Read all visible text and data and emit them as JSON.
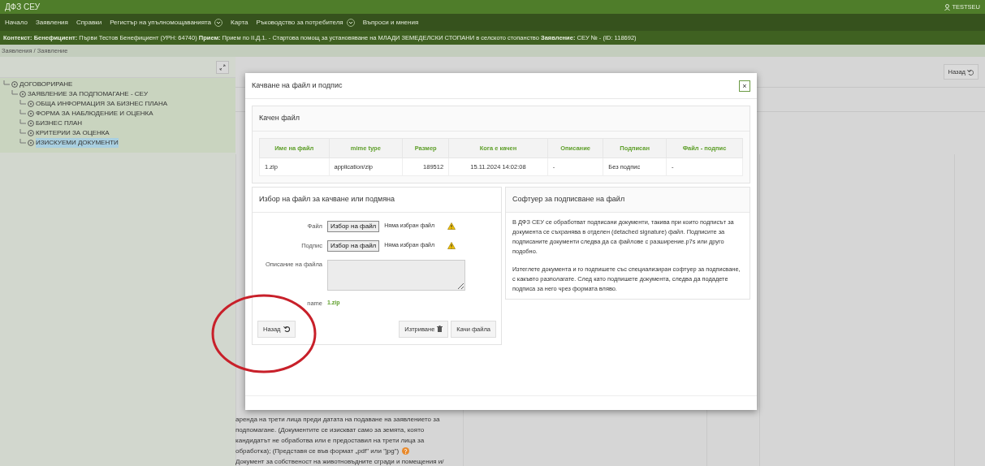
{
  "header": {
    "brand": "ДФЗ СЕУ",
    "user": "TESTSEU"
  },
  "nav": [
    {
      "label": "Начало",
      "dropdown": false
    },
    {
      "label": "Заявления",
      "dropdown": false
    },
    {
      "label": "Справки",
      "dropdown": false
    },
    {
      "label": "Регистър на упълномощаванията",
      "dropdown": true
    },
    {
      "label": "Карта",
      "dropdown": false
    },
    {
      "label": "Ръководство за потребителя",
      "dropdown": true
    },
    {
      "label": "Въпроси и мнения",
      "dropdown": false
    }
  ],
  "context": "**Контекст:** **Бенефициент:** Първи Тестов Бенефициент (УРН: 64740) **Прием:** Прием по II.Д.1. - Стартова помощ за установяване на МЛАДИ ЗЕМЕДЕЛСКИ СТОПАНИ в селското стопанство **Заявление:** СЕУ № - (ID: 118692)",
  "breadcrumb": "Заявления / Заявление",
  "tree": [
    {
      "label": "ДОГОВОРИРАНЕ",
      "selected": false,
      "children": [
        {
          "label": "ЗАЯВЛЕНИЕ ЗА ПОДПОМАГАНЕ - СЕУ",
          "selected": false,
          "children": [
            {
              "label": "ОБЩА ИНФОРМАЦИЯ ЗА БИЗНЕС ПЛАНА",
              "selected": false
            },
            {
              "label": "ФОРМА ЗА НАБЛЮДЕНИЕ И ОЦЕНКА",
              "selected": false
            },
            {
              "label": "БИЗНЕС ПЛАН",
              "selected": false
            },
            {
              "label": "КРИТЕРИИ ЗА ОЦЕНКА",
              "selected": false
            },
            {
              "label": "ИЗИСКУЕМИ ДОКУМЕНТИ",
              "selected": true
            }
          ]
        }
      ]
    }
  ],
  "back_button": "Назад",
  "background_text": [
    "аренда на трети лица преди датата на подаване на заявлението за",
    "подпомагане. (Документите се изискват само за земята, която",
    "кандидатът не обработва или е предоставил на трети лица за",
    "обработка); (Представя се във формат „pdf\" или \"jpg\")",
    "Документ за собственост на животновъдните сгради и помещения и/"
  ],
  "modal": {
    "title": "Качване на файл и подпис",
    "close": "×",
    "uploaded": {
      "title": "Качен файл",
      "columns": [
        "Име на файл",
        "mime type",
        "Размер",
        "Кога е качен",
        "Описание",
        "Подписан",
        "Файл - подпис"
      ],
      "rows": [
        [
          "1.zip",
          "application/zip",
          "189512",
          "15.11.2024 14:02:08",
          "-",
          "Без подпис",
          "-"
        ]
      ]
    },
    "form": {
      "title": "Избор на файл за качване или подмяна",
      "file_inputs": [
        {
          "label": "Файл",
          "button": "Избор на файл",
          "status": "Няма избран файл"
        },
        {
          "label": "Подпис",
          "button": "Избор на файл",
          "status": "Няма избран файл"
        }
      ],
      "description_label": "Описание на файла",
      "filename_label": "name",
      "filename": "1.zip",
      "buttons": [
        {
          "label": "Назад",
          "kind": "back"
        },
        {
          "label": "Изтриване",
          "kind": "delete"
        },
        {
          "label": "Качи файла",
          "kind": "upload"
        }
      ]
    },
    "software": {
      "title": "Софтуер за подписване на файл",
      "paragraphs": [
        "В ДФЗ СЕУ се обработват подписани документи, такива при които подписът за документа се съхранява в отделен (detached signature) файл. Подписите за подписаните документи следва да са файлове с разширение.p7s или друго подобно.",
        "Изтеглете документа и го подпишете със специализиран софтуер за подписване, с какъвто разполагате. След като подпишете документа, следва да подадете подписа за него чрез формата вляво."
      ]
    }
  }
}
